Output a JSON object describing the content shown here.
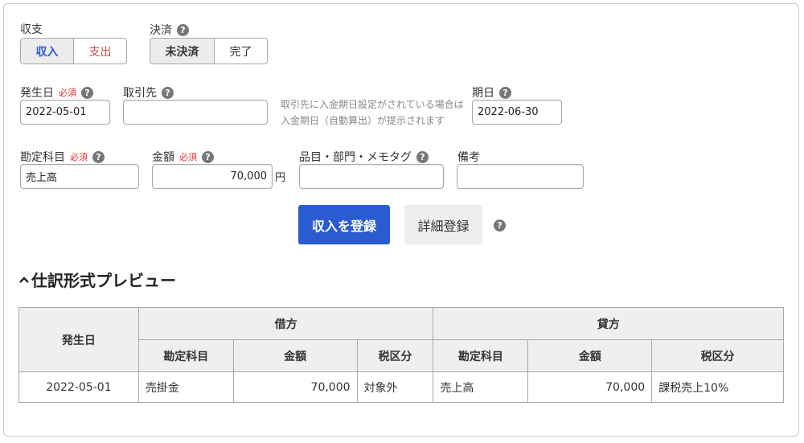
{
  "type_field": {
    "label": "収支",
    "options": [
      "収入",
      "支出"
    ],
    "selected": "収入"
  },
  "settlement": {
    "label": "決済",
    "options": [
      "未決済",
      "完了"
    ],
    "selected": "未決済"
  },
  "date_field": {
    "label": "発生日",
    "required": "必須",
    "value": "2022-05-01"
  },
  "partner_field": {
    "label": "取引先",
    "value": ""
  },
  "partner_hint": [
    "取引先に入金期日設定がされている場合は",
    "入金期日（自動算出）が提示されます"
  ],
  "due_field": {
    "label": "期日",
    "value": "2022-06-30"
  },
  "account_field": {
    "label": "勘定科目",
    "required": "必須",
    "value": "売上高"
  },
  "amount_field": {
    "label": "金額",
    "required": "必須",
    "value": "70,000",
    "unit": "円"
  },
  "tags_field": {
    "label": "品目・部門・メモタグ",
    "value": ""
  },
  "note_field": {
    "label": "備考",
    "value": ""
  },
  "actions": {
    "submit": "収入を登録",
    "detail": "詳細登録"
  },
  "preview": {
    "title": "仕訳形式プレビュー",
    "headers": {
      "date": "発生日",
      "debit": "借方",
      "credit": "貸方",
      "account": "勘定科目",
      "amount": "金額",
      "tax": "税区分"
    },
    "rows": [
      {
        "date": "2022-05-01",
        "debit_account": "売掛金",
        "debit_amount": "70,000",
        "debit_tax": "対象外",
        "credit_account": "売上高",
        "credit_amount": "70,000",
        "credit_tax": "課税売上10%"
      }
    ]
  },
  "colors": {
    "accent": "#2a5bd1",
    "income": "#2a5bd1",
    "expense": "#d34a4a",
    "required": "#dd3333"
  },
  "icons": {
    "help": "question-circle-icon",
    "collapse": "chevron-up-icon"
  }
}
